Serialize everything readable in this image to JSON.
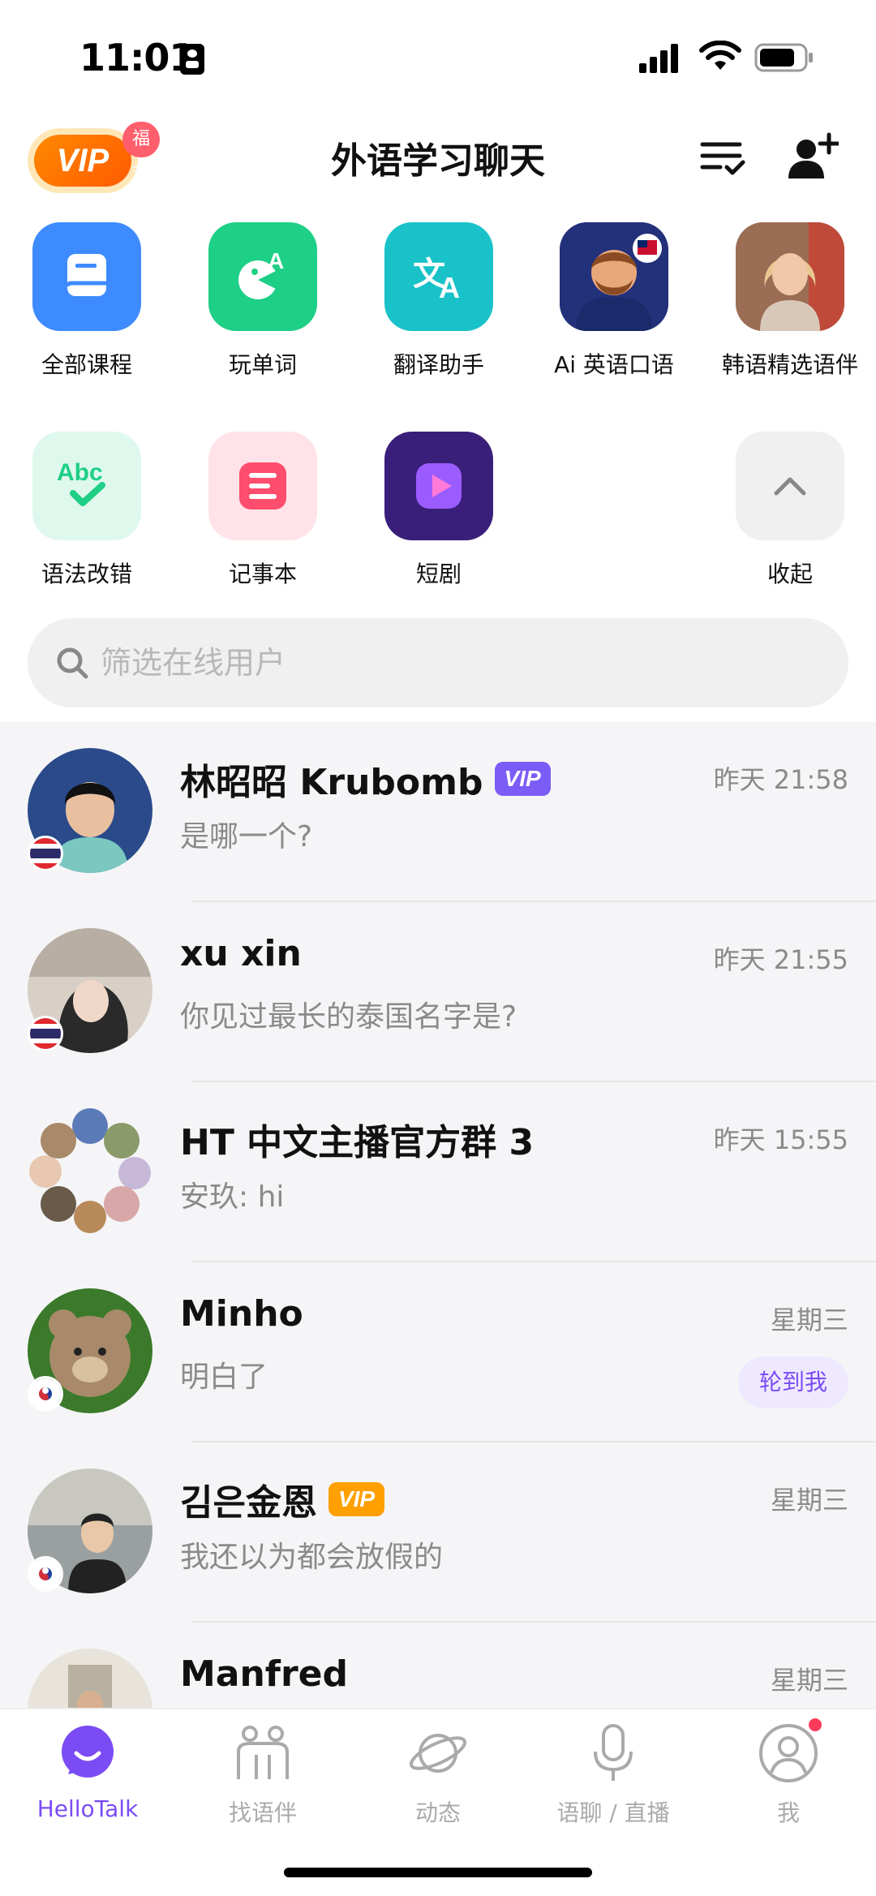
{
  "status_bar": {
    "time": "11:01"
  },
  "header": {
    "vip_label": "VIP",
    "vip_perk": "福利",
    "title": "外语学习聊天"
  },
  "apps": [
    {
      "label": "全部课程",
      "icon": "book-icon",
      "color": "#3d8bff"
    },
    {
      "label": "玩单词",
      "icon": "word-game-icon",
      "color": "#1ecf86"
    },
    {
      "label": "翻译助手",
      "icon": "translate-icon",
      "color": "#19c2c8"
    },
    {
      "label": "Ai 英语口语",
      "icon": "ai-tutor-avatar",
      "color": "#2a3a8f"
    },
    {
      "label": "韩语精选语伴",
      "icon": "partner-photo",
      "color": "#c99a7a"
    },
    {
      "label": "语法改错",
      "icon": "grammar-check-icon",
      "color": "#dff8ee"
    },
    {
      "label": "记事本",
      "icon": "notebook-icon",
      "color": "#ffe3e8"
    },
    {
      "label": "短剧",
      "icon": "play-icon",
      "color": "#3a1f7a"
    },
    {
      "label": "收起",
      "icon": "chevron-up-icon",
      "color": "#f0f0f0"
    }
  ],
  "search": {
    "placeholder": "筛选在线用户"
  },
  "conversations": [
    {
      "name": "林昭昭 Krubomb",
      "vip": "VIP",
      "message": "是哪一个?",
      "time": "昨天 21:58",
      "flag": "thailand"
    },
    {
      "name": "xu xin",
      "message": "你见过最长的泰国名字是?",
      "time": "昨天 21:55",
      "flag": "thailand"
    },
    {
      "name": "HT 中文主播官方群 3",
      "message": "安玖: hi",
      "time": "昨天 15:55"
    },
    {
      "name": "Minho",
      "message": "明白了",
      "time": "星期三",
      "badge": "轮到我",
      "flag": "korea"
    },
    {
      "name": "김은金恩",
      "vip": "VIP",
      "message": "我还以为都会放假的",
      "time": "星期三",
      "flag": "korea"
    },
    {
      "name": "Manfred",
      "message": "",
      "time": "星期三"
    }
  ],
  "tabs": [
    {
      "label": "HelloTalk",
      "icon": "hellotalk-icon",
      "active": true
    },
    {
      "label": "找语伴",
      "icon": "find-partner-icon"
    },
    {
      "label": "动态",
      "icon": "planet-icon"
    },
    {
      "label": "语聊 / 直播",
      "icon": "microphone-icon"
    },
    {
      "label": "我",
      "icon": "profile-icon"
    }
  ],
  "colors": {
    "accent": "#7b4cf5",
    "vip_orange": "#ff9f00",
    "notification_red": "#ff3b5c"
  }
}
